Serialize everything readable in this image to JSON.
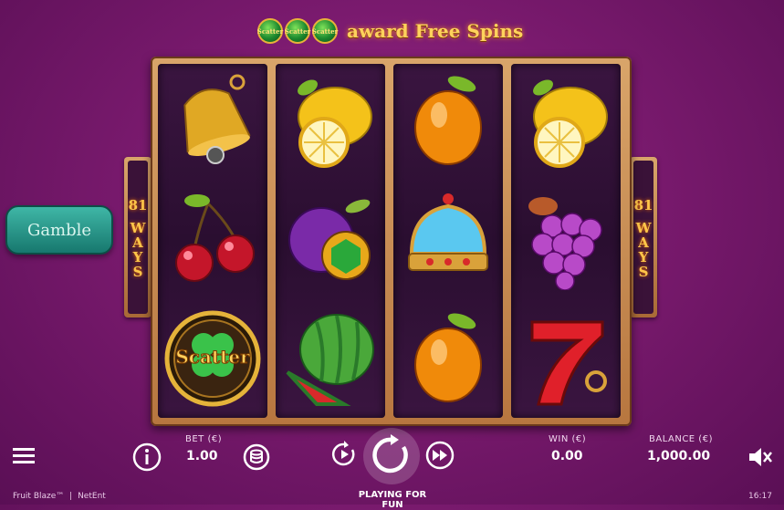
{
  "banner": {
    "scatter_label": "Scatter",
    "text": "award Free Spins"
  },
  "side": {
    "ways_number": "81",
    "ways_label": "WAYS"
  },
  "gamble": {
    "label": "Gamble"
  },
  "reels": [
    [
      "bell",
      "cherries",
      "scatter"
    ],
    [
      "lemon",
      "plum",
      "watermelon"
    ],
    [
      "orange",
      "crown",
      "orange"
    ],
    [
      "lemon",
      "grapes",
      "seven"
    ]
  ],
  "scatter_symbol_text": "Scatter",
  "hud": {
    "bet_label": "BET (€)",
    "bet_value": "1.00",
    "win_label": "WIN (€)",
    "win_value": "0.00",
    "balance_label": "BALANCE (€)",
    "balance_value": "1,000.00",
    "playing_text": "PLAYING FOR FUN"
  },
  "footer": {
    "game_name": "Fruit Blaze™",
    "separator": "|",
    "provider": "NetEnt",
    "clock": "16:17"
  },
  "colors": {
    "accent_gold": "#ffd25c",
    "background": "#7a1a6e",
    "gamble_button": "#2a9a8c"
  }
}
